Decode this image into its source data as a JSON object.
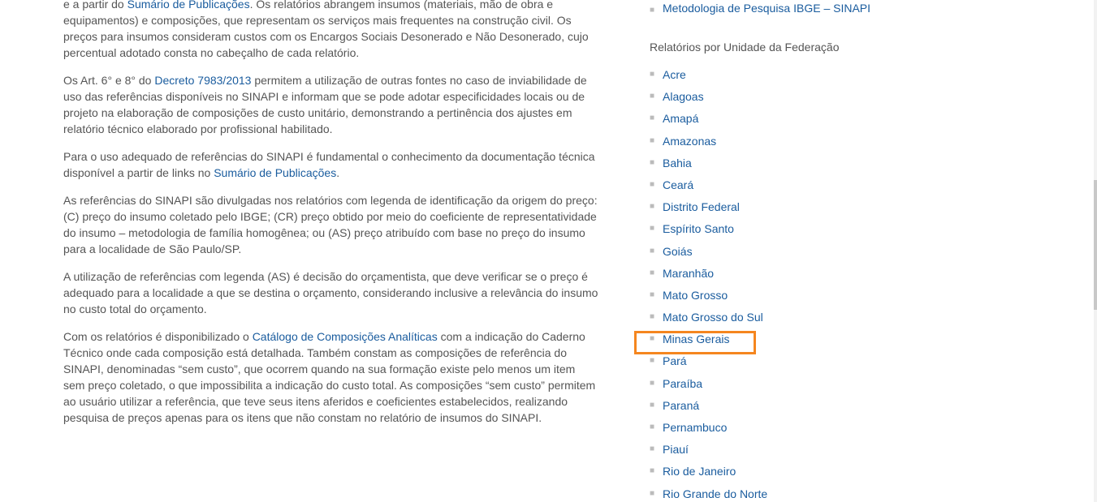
{
  "main": {
    "p1": {
      "t1": "e a partir do ",
      "link1": "Sumário de Publicações",
      "t2": ". Os relatórios abrangem insumos (materiais, mão de obra e equipamentos) e composições, que representam os serviços mais frequentes na construção civil. Os preços para insumos consideram custos com os Encargos Sociais Desonerado e Não Desonerado, cujo percentual adotado consta no cabeçalho de cada relatório."
    },
    "p2": {
      "t1": "Os Art. 6° e 8° do ",
      "link1": "Decreto 7983/2013",
      "t2": " permitem a utilização de outras fontes no caso de inviabilidade de uso das referências disponíveis no SINAPI e informam que se pode adotar especificidades locais ou de projeto na elaboração de composições de custo unitário, demonstrando a pertinência dos ajustes em relatório técnico elaborado por profissional habilitado."
    },
    "p3": {
      "t1": "Para o uso adequado de referências do SINAPI é fundamental o conhecimento da documentação técnica disponível a partir de links no ",
      "link1": "Sumário de Publicações",
      "t2": "."
    },
    "p4": {
      "t1": "As referências do SINAPI são divulgadas nos relatórios com legenda de identificação da origem do preço: (C) preço do insumo coletado pelo IBGE; (CR) preço obtido por meio do coeficiente de representatividade do insumo – metodologia de família homogênea; ou (AS) preço atribuído com base no preço do insumo para a localidade de São Paulo/SP."
    },
    "p5": {
      "t1": "A utilização de referências com legenda (AS) é decisão do orçamentista, que deve verificar se o preço é adequado para a localidade a que se destina o orçamento, considerando inclusive a relevância do insumo no custo total do orçamento."
    },
    "p6": {
      "t1": "Com os relatórios é disponibilizado o ",
      "link1": "Catálogo de Composições Analíticas",
      "t2": " com a indicação do Caderno Técnico onde cada composição está detalhada. Também constam as composições de referência do SINAPI, denominadas “sem custo”, que ocorrem quando na sua formação existe pelo menos um item sem preço coletado, o que impossibilita a indicação do custo total. As composições “sem custo” permitem ao usuário utilizar a referência, que teve seus itens aferidos e coeficientes estabelecidos, realizando pesquisa de preços apenas para os itens que não constam no relatório de insumos do SINAPI."
    }
  },
  "sidebar": {
    "top_link": "Metodologia de Pesquisa IBGE – SINAPI",
    "heading": "Relatórios por Unidade da Federação",
    "bullet": "■",
    "states": [
      "Acre",
      "Alagoas",
      "Amapá",
      "Amazonas",
      "Bahia",
      "Ceará",
      "Distrito Federal",
      "Espírito Santo",
      "Goiás",
      "Maranhão",
      "Mato Grosso",
      "Mato Grosso do Sul",
      "Minas Gerais",
      "Pará",
      "Paraíba",
      "Paraná",
      "Pernambuco",
      "Piauí",
      "Rio de Janeiro",
      "Rio Grande do Norte"
    ]
  },
  "colors": {
    "text": "#555555",
    "link": "#1a5c9e",
    "highlight": "#f5861f"
  }
}
